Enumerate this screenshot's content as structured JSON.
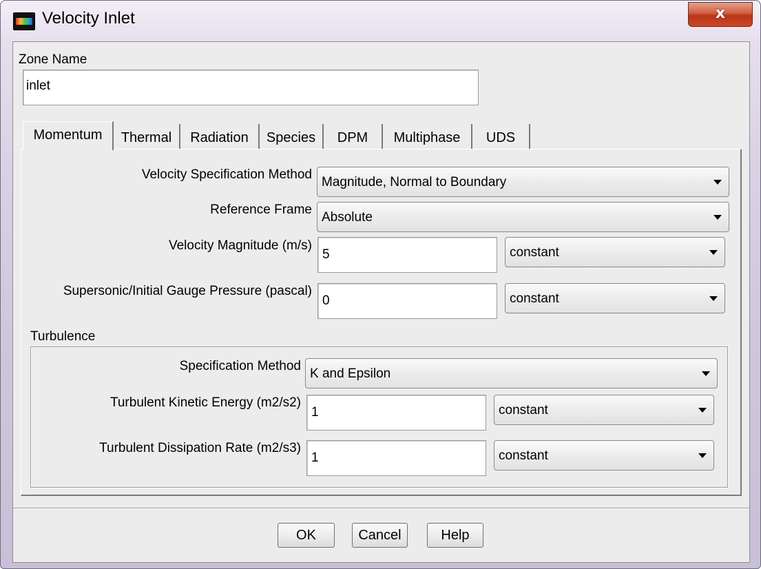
{
  "window": {
    "title": "Velocity Inlet",
    "close_symbol": "x",
    "app_icon": "fluent-app-icon"
  },
  "zone": {
    "label": "Zone Name",
    "value": "inlet"
  },
  "tabs": [
    {
      "label": "Momentum",
      "active": true
    },
    {
      "label": "Thermal",
      "active": false
    },
    {
      "label": "Radiation",
      "active": false
    },
    {
      "label": "Species",
      "active": false
    },
    {
      "label": "DPM",
      "active": false
    },
    {
      "label": "Multiphase",
      "active": false
    },
    {
      "label": "UDS",
      "active": false
    }
  ],
  "momentum": {
    "velocity_spec": {
      "label": "Velocity Specification Method",
      "value": "Magnitude, Normal to Boundary"
    },
    "reference_frame": {
      "label": "Reference Frame",
      "value": "Absolute"
    },
    "velocity_magnitude": {
      "label": "Velocity Magnitude (m/s)",
      "value": "5",
      "profile": "constant"
    },
    "gauge_pressure": {
      "label": "Supersonic/Initial Gauge Pressure (pascal)",
      "value": "0",
      "profile": "constant"
    }
  },
  "turbulence": {
    "label": "Turbulence",
    "spec_method": {
      "label": "Specification Method",
      "value": "K and Epsilon"
    },
    "kinetic_energy": {
      "label": "Turbulent Kinetic Energy (m2/s2)",
      "value": "1",
      "profile": "constant"
    },
    "dissipation_rate": {
      "label": "Turbulent Dissipation Rate (m2/s3)",
      "value": "1",
      "profile": "constant"
    }
  },
  "buttons": {
    "ok": "OK",
    "cancel": "Cancel",
    "help": "Help"
  },
  "colors": {
    "close_button": "#c84a2a",
    "dialog_bg": "#ececec"
  }
}
